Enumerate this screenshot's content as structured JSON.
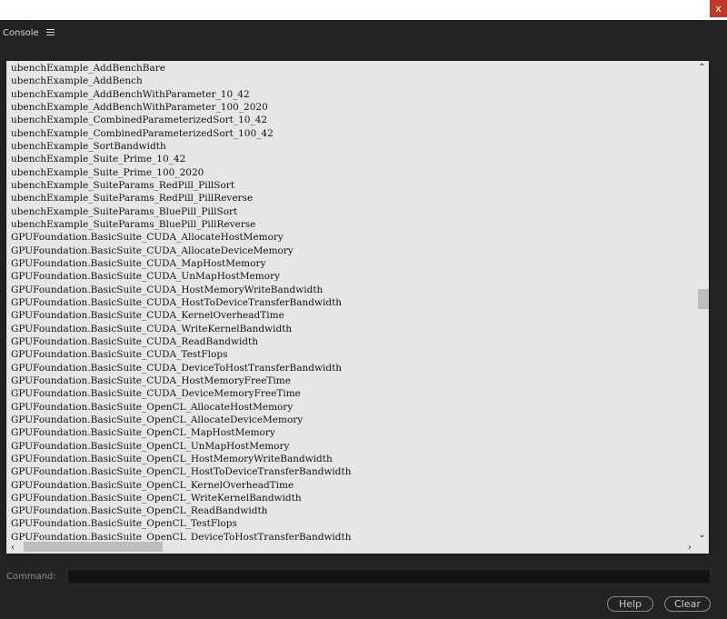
{
  "window": {
    "close_label": "x"
  },
  "panel": {
    "title": "Console"
  },
  "console": {
    "lines": [
      "ubenchExample_AddBenchBare",
      "ubenchExample_AddBench",
      "ubenchExample_AddBenchWithParameter_10_42",
      "ubenchExample_AddBenchWithParameter_100_2020",
      "ubenchExample_CombinedParameterizedSort_10_42",
      "ubenchExample_CombinedParameterizedSort_100_42",
      "ubenchExample_SortBandwidth",
      "ubenchExample_Suite_Prime_10_42",
      "ubenchExample_Suite_Prime_100_2020",
      "ubenchExample_SuiteParams_RedPill_PillSort",
      "ubenchExample_SuiteParams_RedPill_PillReverse",
      "ubenchExample_SuiteParams_BluePill_PillSort",
      "ubenchExample_SuiteParams_BluePill_PillReverse",
      "GPUFoundation.BasicSuite_CUDA_AllocateHostMemory",
      "GPUFoundation.BasicSuite_CUDA_AllocateDeviceMemory",
      "GPUFoundation.BasicSuite_CUDA_MapHostMemory",
      "GPUFoundation.BasicSuite_CUDA_UnMapHostMemory",
      "GPUFoundation.BasicSuite_CUDA_HostMemoryWriteBandwidth",
      "GPUFoundation.BasicSuite_CUDA_HostToDeviceTransferBandwidth",
      "GPUFoundation.BasicSuite_CUDA_KernelOverheadTime",
      "GPUFoundation.BasicSuite_CUDA_WriteKernelBandwidth",
      "GPUFoundation.BasicSuite_CUDA_ReadBandwidth",
      "GPUFoundation.BasicSuite_CUDA_TestFlops",
      "GPUFoundation.BasicSuite_CUDA_DeviceToHostTransferBandwidth",
      "GPUFoundation.BasicSuite_CUDA_HostMemoryFreeTime",
      "GPUFoundation.BasicSuite_CUDA_DeviceMemoryFreeTime",
      "GPUFoundation.BasicSuite_OpenCL_AllocateHostMemory",
      "GPUFoundation.BasicSuite_OpenCL_AllocateDeviceMemory",
      "GPUFoundation.BasicSuite_OpenCL_MapHostMemory",
      "GPUFoundation.BasicSuite_OpenCL_UnMapHostMemory",
      "GPUFoundation.BasicSuite_OpenCL_HostMemoryWriteBandwidth",
      "GPUFoundation.BasicSuite_OpenCL_HostToDeviceTransferBandwidth",
      "GPUFoundation.BasicSuite_OpenCL_KernelOverheadTime",
      "GPUFoundation.BasicSuite_OpenCL_WriteKernelBandwidth",
      "GPUFoundation.BasicSuite_OpenCL_ReadBandwidth",
      "GPUFoundation.BasicSuite_OpenCL_TestFlops",
      "GPUFoundation.BasicSuite_OpenCL_DeviceToHostTransferBandwidth"
    ]
  },
  "command": {
    "label": "Command:",
    "value": ""
  },
  "buttons": {
    "help": "Help",
    "clear": "Clear"
  }
}
